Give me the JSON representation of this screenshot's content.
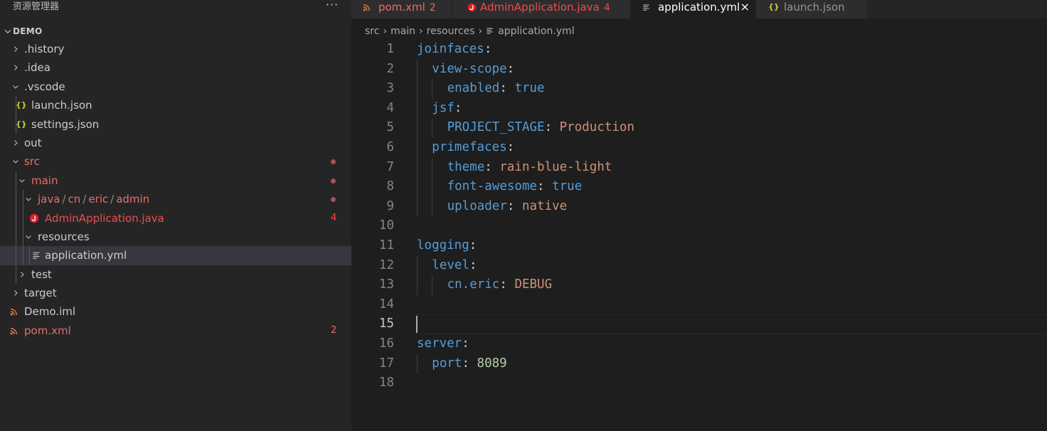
{
  "explorer": {
    "title": "资源管理器",
    "more_label": "···",
    "section": "DEMO"
  },
  "tree": [
    {
      "label": "history",
      "kind": "folder"
    },
    {
      "label": "idea",
      "kind": "folder"
    },
    {
      "label": ".vscode",
      "kind": "folder-open"
    },
    {
      "label": "launch.json",
      "kind": "json"
    },
    {
      "label": "settings.json",
      "kind": "json"
    },
    {
      "label": "out",
      "kind": "folder"
    },
    {
      "label": "src",
      "kind": "folder-open",
      "status": "modified"
    },
    {
      "label": "main",
      "kind": "folder-open",
      "status": "modified"
    },
    {
      "label": "java / cn / eric / admin",
      "parts": [
        "java",
        "cn",
        "eric",
        "admin"
      ],
      "kind": "folder-open",
      "status": "modified"
    },
    {
      "label": "AdminApplication.java",
      "kind": "java",
      "status": "error",
      "badge": "4"
    },
    {
      "label": "resources",
      "kind": "folder-open"
    },
    {
      "label": "application.yml",
      "kind": "yaml",
      "selected": true
    },
    {
      "label": "test",
      "kind": "folder"
    },
    {
      "label": "target",
      "kind": "folder"
    },
    {
      "label": "Demo.iml",
      "kind": "rss"
    },
    {
      "label": "pom.xml",
      "kind": "rss",
      "status": "modified",
      "badge": "2"
    }
  ],
  "tabs": [
    {
      "label": "pom.xml",
      "badge": "2",
      "icon": "rss-icon"
    },
    {
      "label": "AdminApplication.java",
      "badge": "4",
      "icon": "java-error-icon"
    },
    {
      "label": "application.yml",
      "icon": "yaml-file-icon",
      "active": true,
      "close": "×"
    },
    {
      "label": "launch.json",
      "icon": "json-braces-icon"
    }
  ],
  "breadcrumb": [
    "src",
    "main",
    "resources",
    "application.yml"
  ],
  "editor": {
    "current_line": 15,
    "lines": [
      {
        "n": "1",
        "key": "joinfaces",
        "val": "",
        "vtype": ""
      },
      {
        "n": "2",
        "key": "view-scope",
        "val": "",
        "vtype": ""
      },
      {
        "n": "3",
        "key": "enabled",
        "val": "true",
        "vtype": "bool"
      },
      {
        "n": "4",
        "key": "jsf",
        "val": "",
        "vtype": ""
      },
      {
        "n": "5",
        "key": "PROJECT_STAGE",
        "val": "Production",
        "vtype": "string"
      },
      {
        "n": "6",
        "key": "primefaces",
        "val": "",
        "vtype": ""
      },
      {
        "n": "7",
        "key": "theme",
        "val": "rain-blue-light",
        "vtype": "string"
      },
      {
        "n": "8",
        "key": "font-awesome",
        "val": "true",
        "vtype": "bool"
      },
      {
        "n": "9",
        "key": "uploader",
        "val": "native",
        "vtype": "string"
      },
      {
        "n": "10",
        "key": "",
        "val": "",
        "vtype": ""
      },
      {
        "n": "11",
        "key": "logging",
        "val": "",
        "vtype": ""
      },
      {
        "n": "12",
        "key": "level",
        "val": "",
        "vtype": ""
      },
      {
        "n": "13",
        "key": "cn.eric",
        "val": "DEBUG",
        "vtype": "string"
      },
      {
        "n": "14",
        "key": "",
        "val": "",
        "vtype": ""
      },
      {
        "n": "15",
        "key": "",
        "val": "",
        "vtype": ""
      },
      {
        "n": "16",
        "key": "server",
        "val": "",
        "vtype": ""
      },
      {
        "n": "17",
        "key": "port",
        "val": "8089",
        "vtype": "number"
      },
      {
        "n": "18",
        "key": "",
        "val": "",
        "vtype": ""
      }
    ]
  },
  "colors": {
    "git_modified": "#e3706b",
    "git_error": "#f14c4c",
    "yaml_key": "#569cd6",
    "yaml_string": "#ce9178",
    "yaml_number": "#b5cea8"
  }
}
